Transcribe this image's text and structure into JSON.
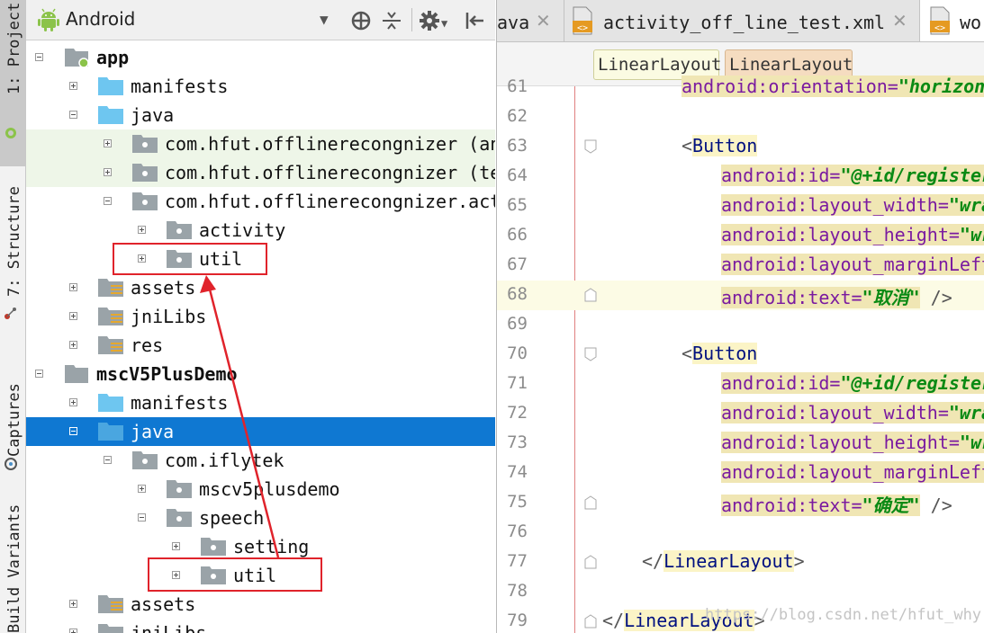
{
  "tool_strip": {
    "tabs": [
      {
        "label": "1: Project"
      },
      {
        "label": "7: Structure"
      },
      {
        "label": "Captures"
      },
      {
        "label": "Build Variants"
      }
    ]
  },
  "project_panel": {
    "view_mode": "Android",
    "tree": [
      {
        "label": "app"
      },
      {
        "label": "manifests"
      },
      {
        "label": "java"
      },
      {
        "label": "com.hfut.offlinerecongnizer (androidTest)"
      },
      {
        "label": "com.hfut.offlinerecongnizer (test)"
      },
      {
        "label": "com.hfut.offlinerecongnizer.activity"
      },
      {
        "label": "activity"
      },
      {
        "label": "util"
      },
      {
        "label": "assets"
      },
      {
        "label": "jniLibs"
      },
      {
        "label": "res"
      },
      {
        "label": "mscV5PlusDemo"
      },
      {
        "label": "manifests"
      },
      {
        "label": "java"
      },
      {
        "label": "com.iflytek"
      },
      {
        "label": "mscv5plusdemo"
      },
      {
        "label": "speech"
      },
      {
        "label": "setting"
      },
      {
        "label": "util"
      },
      {
        "label": "assets"
      },
      {
        "label": "jniLibs"
      }
    ]
  },
  "editor": {
    "tabs": [
      {
        "label": "ava"
      },
      {
        "label": "activity_off_line_test.xml"
      },
      {
        "label": "wor"
      }
    ],
    "breadcrumbs": [
      "LinearLayout",
      "LinearLayout"
    ],
    "lines": [
      {
        "n": "61",
        "pre": "",
        "tag": "",
        "ns": "android:",
        "attr": "orientation=",
        "val": "\"horizon",
        "post": ""
      },
      {
        "n": "62",
        "pre": "",
        "tag": "",
        "ns": "",
        "attr": "",
        "val": "",
        "post": ""
      },
      {
        "n": "63",
        "pre": "<",
        "tag": "Button",
        "ns": "",
        "attr": "",
        "val": "",
        "post": ""
      },
      {
        "n": "64",
        "pre": "",
        "tag": "",
        "ns": "android:",
        "attr": "id=",
        "val": "\"@+id/register",
        "post": ""
      },
      {
        "n": "65",
        "pre": "",
        "tag": "",
        "ns": "android:",
        "attr": "layout_width=",
        "val": "\"wra",
        "post": ""
      },
      {
        "n": "66",
        "pre": "",
        "tag": "",
        "ns": "android:",
        "attr": "layout_height=",
        "val": "\"wr",
        "post": ""
      },
      {
        "n": "67",
        "pre": "",
        "tag": "",
        "ns": "android:",
        "attr": "layout_marginLeft",
        "val": "",
        "post": ""
      },
      {
        "n": "68",
        "pre": "",
        "tag": "",
        "ns": "android:",
        "attr": "text=",
        "val": "\"取消\"",
        "post": " />"
      },
      {
        "n": "69",
        "pre": "",
        "tag": "",
        "ns": "",
        "attr": "",
        "val": "",
        "post": ""
      },
      {
        "n": "70",
        "pre": "<",
        "tag": "Button",
        "ns": "",
        "attr": "",
        "val": "",
        "post": ""
      },
      {
        "n": "71",
        "pre": "",
        "tag": "",
        "ns": "android:",
        "attr": "id=",
        "val": "\"@+id/register",
        "post": ""
      },
      {
        "n": "72",
        "pre": "",
        "tag": "",
        "ns": "android:",
        "attr": "layout_width=",
        "val": "\"wra",
        "post": ""
      },
      {
        "n": "73",
        "pre": "",
        "tag": "",
        "ns": "android:",
        "attr": "layout_height=",
        "val": "\"wr",
        "post": ""
      },
      {
        "n": "74",
        "pre": "",
        "tag": "",
        "ns": "android:",
        "attr": "layout_marginLeft",
        "val": "",
        "post": ""
      },
      {
        "n": "75",
        "pre": "",
        "tag": "",
        "ns": "android:",
        "attr": "text=",
        "val": "\"确定\"",
        "post": " />"
      },
      {
        "n": "76",
        "pre": "",
        "tag": "",
        "ns": "",
        "attr": "",
        "val": "",
        "post": ""
      },
      {
        "n": "77",
        "pre": "</",
        "tag": "LinearLayout",
        "ns": "",
        "attr": "",
        "val": "",
        "post": ">"
      },
      {
        "n": "78",
        "pre": "",
        "tag": "",
        "ns": "",
        "attr": "",
        "val": "",
        "post": ""
      },
      {
        "n": "79",
        "pre": "</",
        "tag": "LinearLayout",
        "ns": "",
        "attr": "",
        "val": "",
        "post": ">"
      }
    ],
    "watermark": "https://blog.csdn.net/hfut_why"
  },
  "colors": {
    "selection": "#0f78d2",
    "annotation_red": "#e0232b",
    "folder_blue": "#6ec6f0",
    "package_grey": "#9aa3a8",
    "android_green": "#8bc34a",
    "xml_attr_purple": "#7a1aa0",
    "xml_value_green": "#0a8a14"
  }
}
